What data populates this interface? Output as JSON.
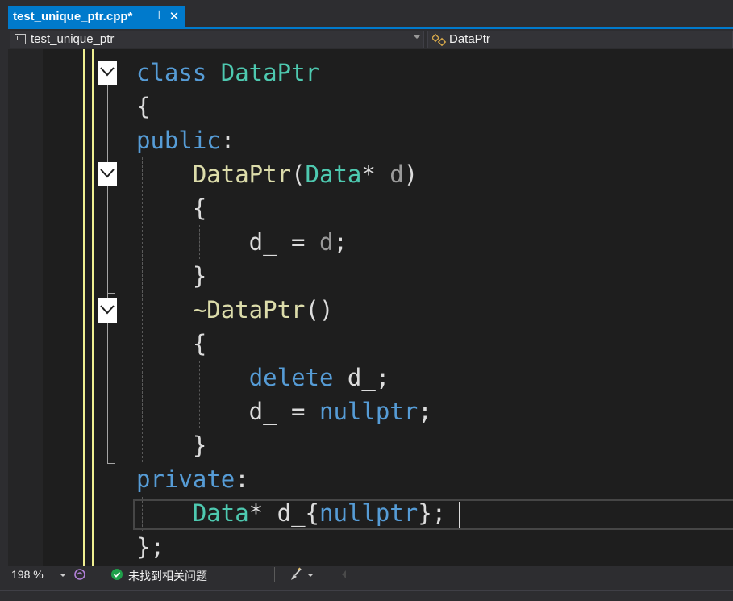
{
  "tab": {
    "title": "test_unique_ptr.cpp*",
    "pin_glyph": "⊣",
    "close_glyph": "✕"
  },
  "navbar": {
    "project": "test_unique_ptr",
    "scope": "DataPtr"
  },
  "code": {
    "lines": [
      [
        {
          "t": "class ",
          "c": "kw"
        },
        {
          "t": "DataPtr",
          "c": "ty"
        }
      ],
      [
        {
          "t": "{",
          "c": "pl"
        }
      ],
      [
        {
          "t": "public",
          "c": "kw"
        },
        {
          "t": ":",
          "c": "pl"
        }
      ],
      [
        {
          "t": "    ",
          "c": "pl"
        },
        {
          "t": "DataPtr",
          "c": "fn"
        },
        {
          "t": "(",
          "c": "pl"
        },
        {
          "t": "Data",
          "c": "ty"
        },
        {
          "t": "* ",
          "c": "pl"
        },
        {
          "t": "d",
          "c": "pm"
        },
        {
          "t": ")",
          "c": "pl"
        }
      ],
      [
        {
          "t": "    {",
          "c": "pl"
        }
      ],
      [
        {
          "t": "        d_ = ",
          "c": "pl"
        },
        {
          "t": "d",
          "c": "pm"
        },
        {
          "t": ";",
          "c": "pl"
        }
      ],
      [
        {
          "t": "    }",
          "c": "pl"
        }
      ],
      [
        {
          "t": "    ",
          "c": "pl"
        },
        {
          "t": "~DataPtr",
          "c": "fn"
        },
        {
          "t": "()",
          "c": "pl"
        }
      ],
      [
        {
          "t": "    {",
          "c": "pl"
        }
      ],
      [
        {
          "t": "        ",
          "c": "pl"
        },
        {
          "t": "delete",
          "c": "kw"
        },
        {
          "t": " d_;",
          "c": "pl"
        }
      ],
      [
        {
          "t": "        d_ = ",
          "c": "pl"
        },
        {
          "t": "nullptr",
          "c": "kw"
        },
        {
          "t": ";",
          "c": "pl"
        }
      ],
      [
        {
          "t": "    }",
          "c": "pl"
        }
      ],
      [
        {
          "t": "private",
          "c": "kw"
        },
        {
          "t": ":",
          "c": "pl"
        }
      ],
      [
        {
          "t": "    ",
          "c": "pl"
        },
        {
          "t": "Data",
          "c": "ty"
        },
        {
          "t": "* d_{",
          "c": "pl"
        },
        {
          "t": "nullptr",
          "c": "kw"
        },
        {
          "t": "};",
          "c": "pl"
        }
      ],
      [
        {
          "t": "};",
          "c": "pl"
        }
      ]
    ]
  },
  "status": {
    "zoom": "198 %",
    "issues": "未找到相关问题"
  },
  "colors": {
    "accent": "#007acc",
    "keyword": "#569cd6",
    "type": "#4ec9b0",
    "function": "#dcdcaa",
    "parameter": "#9a9a9a",
    "plain": "#dcdcdc",
    "change_bar": "#efef91",
    "ok_green": "#1fa04a"
  },
  "icons": {
    "tab_pin": "pin-icon",
    "tab_close": "close-icon",
    "project": "project-icon",
    "scope": "class-icon",
    "collapse": "collapse-chevron-icon",
    "health": "intellicode-health-icon",
    "issues": "check-circle-icon",
    "cleanup": "code-cleanup-brush-icon"
  }
}
